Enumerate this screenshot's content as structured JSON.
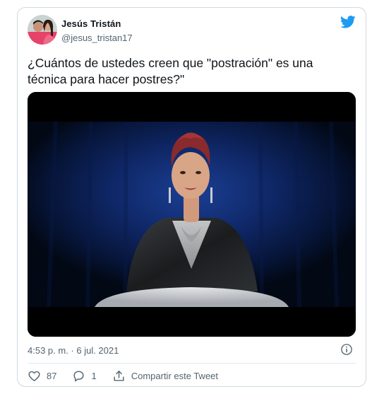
{
  "tweet": {
    "author_name": "Jesús Tristán",
    "author_handle": "@jesus_tristan17",
    "text": "¿Cuántos de ustedes creen que \"postración\" es una técnica para hacer postres?\"",
    "timestamp": "4:53 p. m. · 6 jul. 2021",
    "likes": "87",
    "replies": "1",
    "share_label": "Compartir este Tweet"
  },
  "icons": {
    "brand": "twitter-bird-icon",
    "info": "info-icon",
    "like": "heart-icon",
    "reply": "reply-icon",
    "share": "share-icon"
  },
  "colors": {
    "brand_blue": "#1d9bf0",
    "secondary_text": "#536471",
    "border": "#cfd9de"
  }
}
